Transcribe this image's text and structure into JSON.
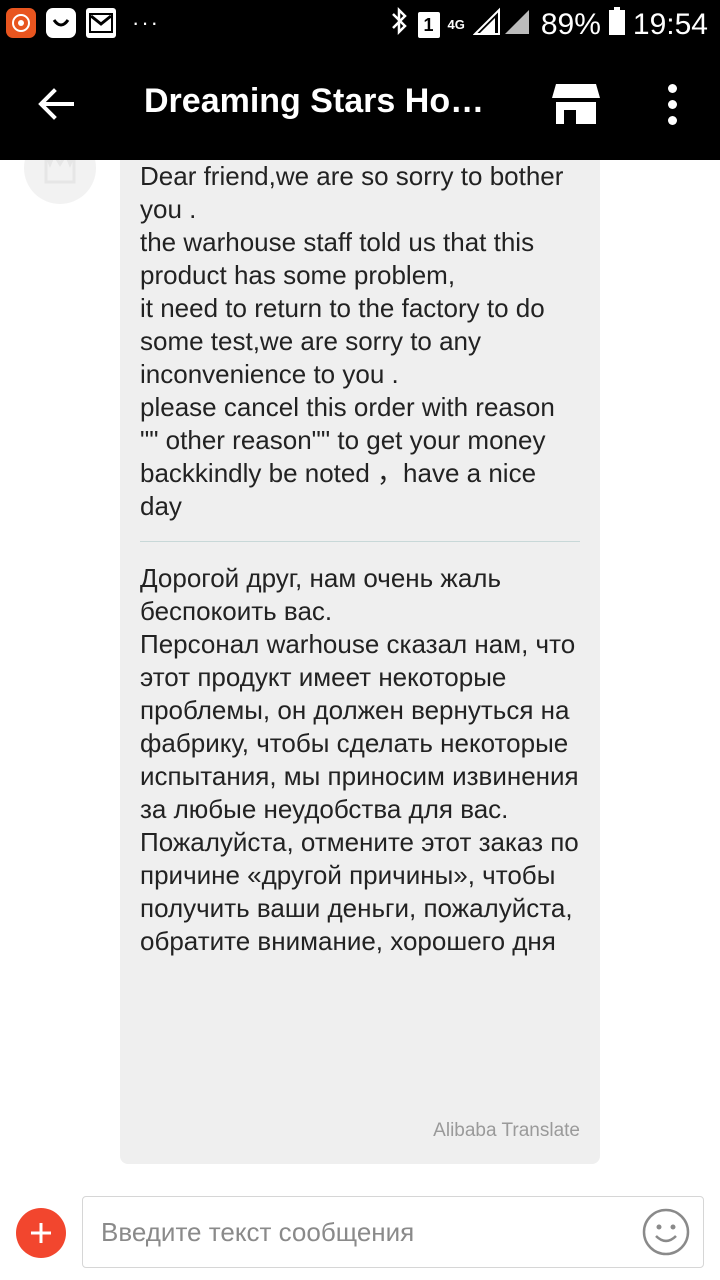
{
  "status_bar": {
    "app_icons": [
      "aliexpress-icon",
      "notification-app-icon",
      "gmail-icon"
    ],
    "more_indicator": "···",
    "sim_badge": "1",
    "network": "4G",
    "battery": "89%",
    "time": "19:54",
    "icons": [
      "bluetooth-icon",
      "signal-icon",
      "battery-icon"
    ]
  },
  "toolbar": {
    "title": "Dreaming Stars Hou…",
    "back_icon": "arrow-left-icon",
    "store_icon": "store-icon",
    "more_icon": "more-vertical-icon"
  },
  "conversation": {
    "message_en": "Dear friend,we are so sorry to bother you .\nthe warhouse staff told us that this product has some problem,\nit need to return to the factory to do some test,we are  sorry to any inconvenience to you .\nplease cancel this order with reason \"\" other reason\"\" to get your money backkindly be noted ，have a nice day",
    "message_ru": "Дорогой друг, нам очень жаль беспокоить вас.\nПерсонал warhouse сказал нам, что этот продукт имеет некоторые проблемы, он должен вернуться на фабрику, чтобы сделать некоторые испытания, мы приносим извинения за любые неудобства для вас.\nПожалуйста, отмените этот заказ по причине «другой причины», чтобы получить ваши деньги, пожалуйста, обратите внимание, хорошего дня",
    "translator_label": "Alibaba Translate"
  },
  "composer": {
    "placeholder": "Введите текст сообщения",
    "value": "",
    "add_icon": "plus-icon",
    "emoji_icon": "smiley-icon"
  },
  "colors": {
    "bars": "#000000",
    "bubble": "#efefef",
    "accent": "#f2462e"
  }
}
